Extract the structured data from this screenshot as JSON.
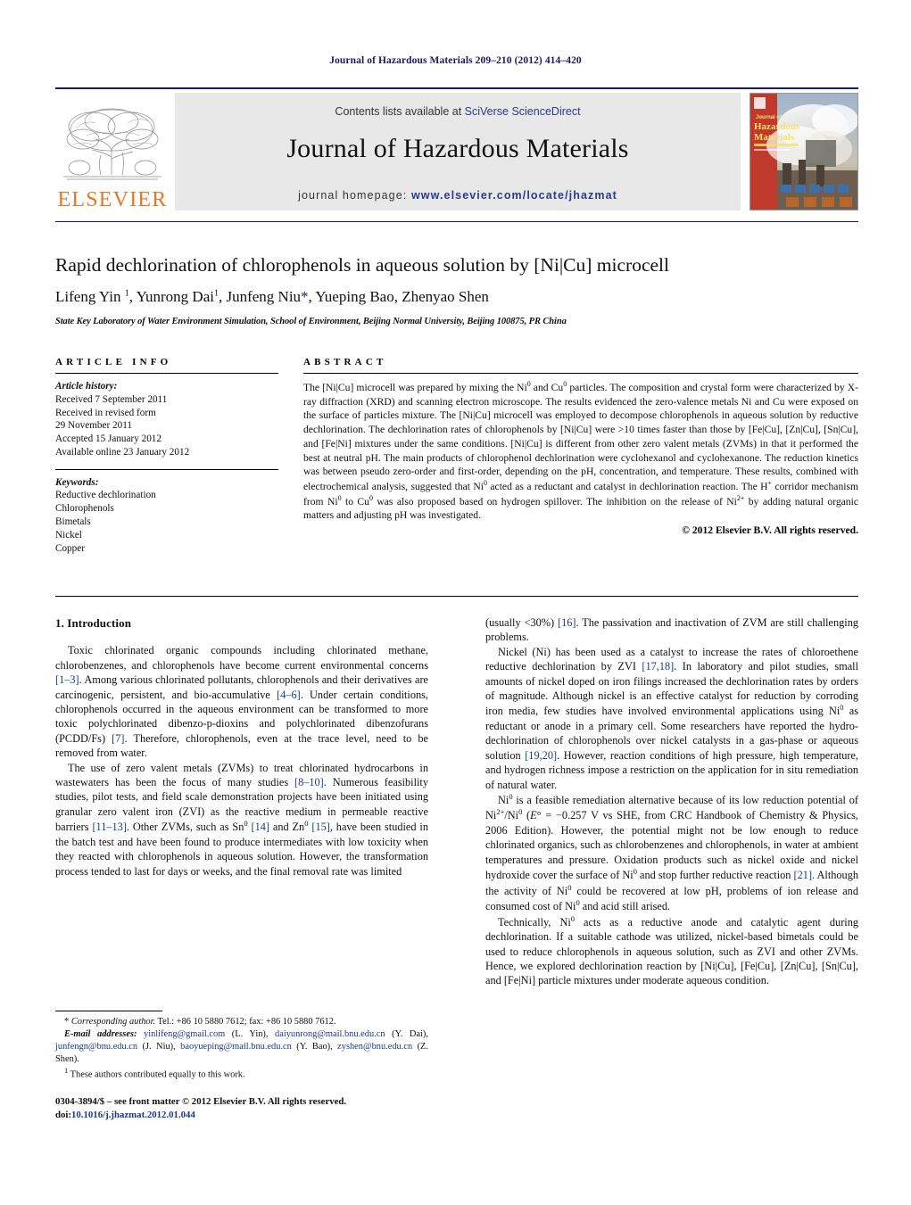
{
  "running_head": "Journal of Hazardous Materials 209–210 (2012) 414–420",
  "masthead": {
    "publisher_name": "ELSEVIER",
    "contents_prefix": "Contents lists available at ",
    "contents_link": "SciVerse ScienceDirect",
    "journal_name": "Journal of Hazardous Materials",
    "homepage_prefix": "journal homepage: ",
    "homepage_url": "www.elsevier.com/locate/jhazmat",
    "cover_title_line1": "Journal of",
    "cover_title_line2": "Hazardous",
    "cover_title_line3": "Materials"
  },
  "article": {
    "title": "Rapid dechlorination of chlorophenols in aqueous solution by [Ni|Cu] microcell",
    "authors_html": "Lifeng Yin <sup>1</sup>, Yunrong Dai<sup>1</sup>, Junfeng Niu<span class=\"star\">*</span>, Yueping Bao, Zhenyao Shen",
    "affiliation": "State Key Laboratory of Water Environment Simulation, School of Environment, Beijing Normal University, Beijing 100875, PR China"
  },
  "article_info": {
    "heading": "ARTICLE INFO",
    "history_label": "Article history:",
    "history": [
      "Received 7 September 2011",
      "Received in revised form",
      "29 November 2011",
      "Accepted 15 January 2012",
      "Available online 23 January 2012"
    ],
    "keywords_label": "Keywords:",
    "keywords": [
      "Reductive dechlorination",
      "Chlorophenols",
      "Bimetals",
      "Nickel",
      "Copper"
    ]
  },
  "abstract": {
    "heading": "ABSTRACT",
    "text_html": "The [Ni|Cu] microcell was prepared by mixing the Ni<sup>0</sup> and Cu<sup>0</sup> particles. The composition and crystal form were characterized by X-ray diffraction (XRD) and scanning electron microscope. The results evidenced the zero-valence metals Ni and Cu were exposed on the surface of particles mixture. The [Ni|Cu] microcell was employed to decompose chlorophenols in aqueous solution by reductive dechlorination. The dechlorination rates of chlorophenols by [Ni|Cu] were &gt;10 times faster than those by [Fe|Cu], [Zn|Cu], [Sn|Cu], and [Fe|Ni] mixtures under the same conditions. [Ni|Cu] is different from other zero valent metals (ZVMs) in that it performed the best at neutral pH. The main products of chlorophenol dechlorination were cyclohexanol and cyclohexanone. The reduction kinetics was between pseudo zero-order and first-order, depending on the pH, concentration, and temperature. These results, combined with electrochemical analysis, suggested that Ni<sup>0</sup> acted as a reductant and catalyst in dechlorination reaction. The H<sup>+</sup> corridor mechanism from Ni<sup>0</sup> to Cu<sup>0</sup> was also proposed based on hydrogen spillover. The inhibition on the release of Ni<sup>2+</sup> by adding natural organic matters and adjusting pH was investigated.",
    "copyright": "© 2012 Elsevier B.V. All rights reserved."
  },
  "body": {
    "section_heading": "1.  Introduction",
    "left_paragraphs_html": [
      "Toxic chlorinated organic compounds including chlorinated methane, chlorobenzenes, and chlorophenols have become current environmental concerns <span class=\"ref\">[1–3]</span>. Among various chlorinated pollutants, chlorophenols and their derivatives are carcinogenic, persistent, and bio-accumulative <span class=\"ref\">[4–6]</span>. Under certain conditions, chlorophenols occurred in the aqueous environment can be transformed to more toxic polychlorinated dibenzo-p-dioxins and polychlorinated dibenzofurans (PCDD/Fs) <span class=\"ref\">[7]</span>. Therefore, chlorophenols, even at the trace level, need to be removed from water.",
      "The use of zero valent metals (ZVMs) to treat chlorinated hydrocarbons in wastewaters has been the focus of many studies <span class=\"ref\">[8–10]</span>. Numerous feasibility studies, pilot tests, and field scale demonstration projects have been initiated using granular zero valent iron (ZVI) as the reactive medium in permeable reactive barriers <span class=\"ref\">[11–13]</span>. Other ZVMs, such as Sn<sup>0</sup> <span class=\"ref\">[14]</span> and Zn<sup>0</sup> <span class=\"ref\">[15]</span>, have been studied in the batch test and have been found to produce intermediates with low toxicity when they reacted with chlorophenols in aqueous solution. However, the transformation process tended to last for days or weeks, and the final removal rate was limited"
    ],
    "right_paragraphs_html": [
      "(usually &lt;30%) <span class=\"ref\">[16]</span>. The passivation and inactivation of ZVM are still challenging problems.",
      "Nickel (Ni) has been used as a catalyst to increase the rates of chloroethene reductive dechlorination by ZVI <span class=\"ref\">[17,18]</span>. In laboratory and pilot studies, small amounts of nickel doped on iron filings increased the dechlorination rates by orders of magnitude. Although nickel is an effective catalyst for reduction by corroding iron media, few studies have involved environmental applications using Ni<sup>0</sup> as reductant or anode in a primary cell. Some researchers have reported the hydro-dechlorination of chlorophenols over nickel catalysts in a gas-phase or aqueous solution <span class=\"ref\">[19,20]</span>. However, reaction conditions of high pressure, high temperature, and hydrogen richness impose a restriction on the application for in situ remediation of natural water.",
      "Ni<sup>0</sup> is a feasible remediation alternative because of its low reduction potential of Ni<sup>2+</sup>/Ni<sup>0</sup> (<i>E</i>° = −0.257 V vs SHE, from CRC Handbook of Chemistry &amp; Physics, 2006 Edition). However, the potential might not be low enough to reduce chlorinated organics, such as chlorobenzenes and chlorophenols, in water at ambient temperatures and pressure. Oxidation products such as nickel oxide and nickel hydroxide cover the surface of Ni<sup>0</sup> and stop further reductive reaction <span class=\"ref\">[21]</span>. Although the activity of Ni<sup>0</sup> could be recovered at low pH, problems of ion release and consumed cost of Ni<sup>0</sup> and acid still arised.",
      "Technically, Ni<sup>0</sup> acts as a reductive anode and catalytic agent during dechlorination. If a suitable cathode was utilized, nickel-based bimetals could be used to reduce chlorophenols in aqueous solution, such as ZVI and other ZVMs. Hence, we explored dechlorination reaction by [Ni|Cu], [Fe|Cu], [Zn|Cu], [Sn|Cu], and [Fe|Ni] particle mixtures under moderate aqueous condition."
    ]
  },
  "footnotes": {
    "corresponding_html": "<span class=\"star\">*</span> <i>Corresponding author.</i> Tel.: +86 10 5880 7612; fax: +86 10 5880 7612.",
    "emails_html": "<span class=\"ital\">E-mail addresses:</span> <span class=\"mail\">yinlifeng@gmail.com</span> (L. Yin), <span class=\"mail\">daiyunrong@mail.bnu.edu.cn</span> (Y. Dai), <span class=\"mail\">junfengn@bnu.edu.cn</span> (J. Niu), <span class=\"mail\">baoyueping@mail.bnu.edu.cn</span> (Y. Bao), <span class=\"mail\">zyshen@bnu.edu.cn</span> (Z. Shen).",
    "equal_contrib_html": "<sup>1</sup> These authors contributed equally to this work."
  },
  "issn": {
    "line1": "0304-3894/$ – see front matter © 2012 Elsevier B.V. All rights reserved.",
    "doi_label": "doi:",
    "doi_value": "10.1016/j.jhazmat.2012.01.044"
  },
  "colors": {
    "journal_navy": "#1a1a5e",
    "link_navy": "#2b3a8f",
    "reference_blue": "#1a3a8f",
    "elsevier_orange": "#e87722",
    "masthead_grey": "#e8e8e8"
  }
}
